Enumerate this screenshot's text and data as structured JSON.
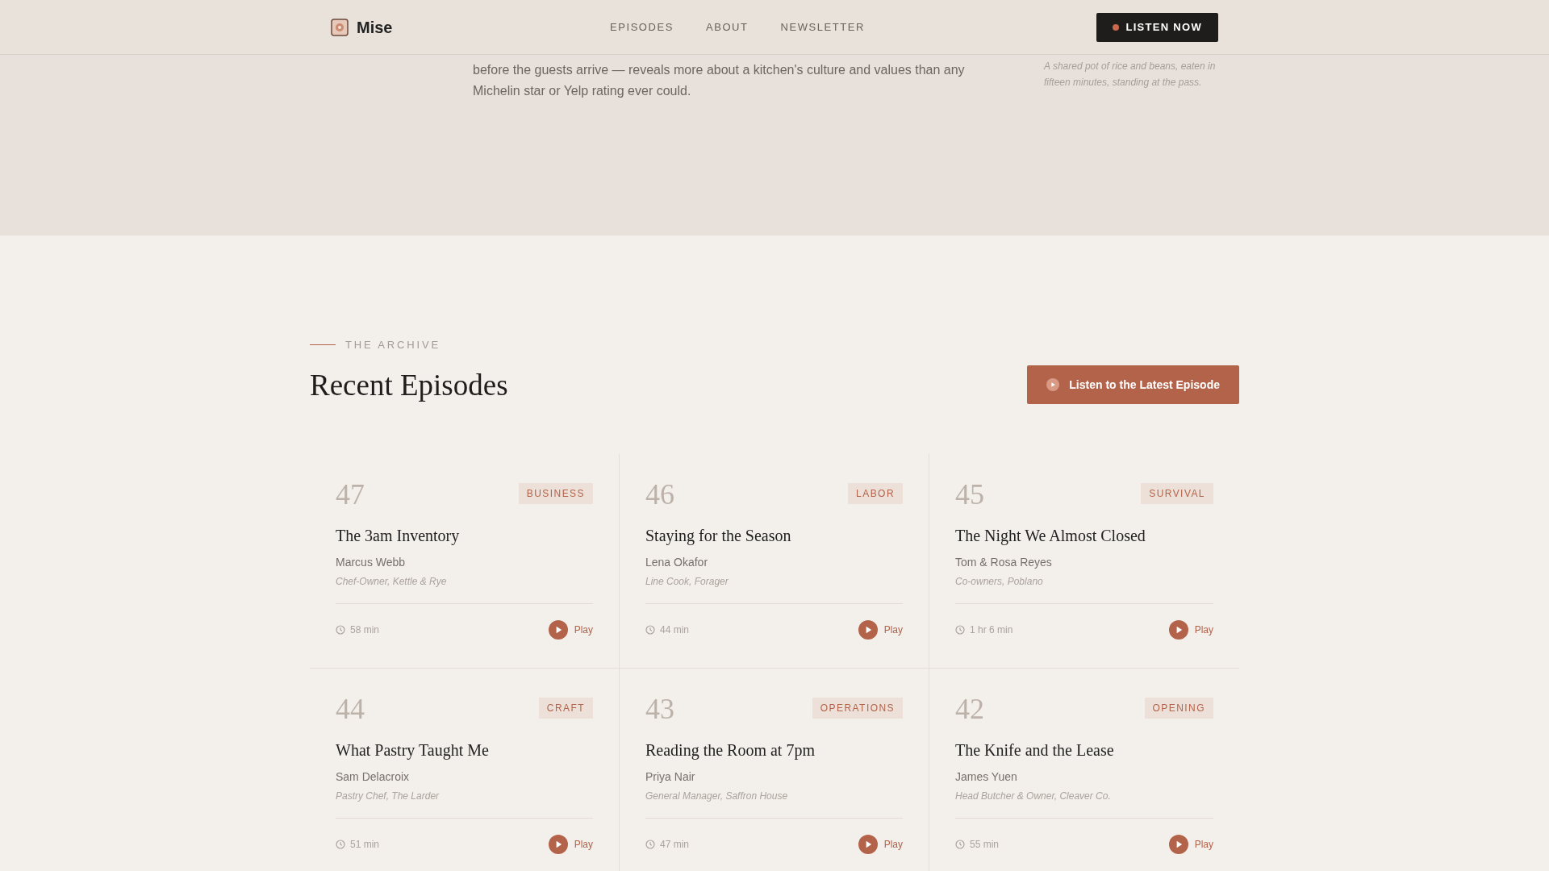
{
  "header": {
    "brand": "Mise",
    "nav": [
      {
        "label": "EPISODES"
      },
      {
        "label": "ABOUT"
      },
      {
        "label": "NEWSLETTER"
      }
    ],
    "cta": "LISTEN NOW"
  },
  "hero": {
    "paragraph_lines": [
      "before the guests arrive — reveals more about a kitchen's culture and values than any",
      "Michelin star or Yelp rating ever could."
    ],
    "caption": "A shared pot of rice and beans, eaten in fifteen minutes, standing at the pass."
  },
  "archive": {
    "eyebrow": "THE ARCHIVE",
    "title": "Recent Episodes",
    "button": "Listen to the Latest Episode",
    "episodes": [
      {
        "number": "47",
        "tag": "BUSINESS",
        "title": "The 3am Inventory",
        "guest": "Marcus Webb",
        "role": "Chef-Owner, Kettle & Rye",
        "duration": "58 min",
        "play": "Play"
      },
      {
        "number": "46",
        "tag": "LABOR",
        "title": "Staying for the Season",
        "guest": "Lena Okafor",
        "role": "Line Cook, Forager",
        "duration": "44 min",
        "play": "Play"
      },
      {
        "number": "45",
        "tag": "SURVIVAL",
        "title": "The Night We Almost Closed",
        "guest": "Tom & Rosa Reyes",
        "role": "Co-owners, Poblano",
        "duration": "1 hr 6 min",
        "play": "Play"
      },
      {
        "number": "44",
        "tag": "CRAFT",
        "title": "What Pastry Taught Me",
        "guest": "Sam Delacroix",
        "role": "Pastry Chef, The Larder",
        "duration": "51 min",
        "play": "Play"
      },
      {
        "number": "43",
        "tag": "OPERATIONS",
        "title": "Reading the Room at 7pm",
        "guest": "Priya Nair",
        "role": "General Manager, Saffron House",
        "duration": "47 min",
        "play": "Play"
      },
      {
        "number": "42",
        "tag": "OPENING",
        "title": "The Knife and the Lease",
        "guest": "James Yuen",
        "role": "Head Butcher & Owner, Cleaver Co.",
        "duration": "55 min",
        "play": "Play"
      }
    ]
  }
}
